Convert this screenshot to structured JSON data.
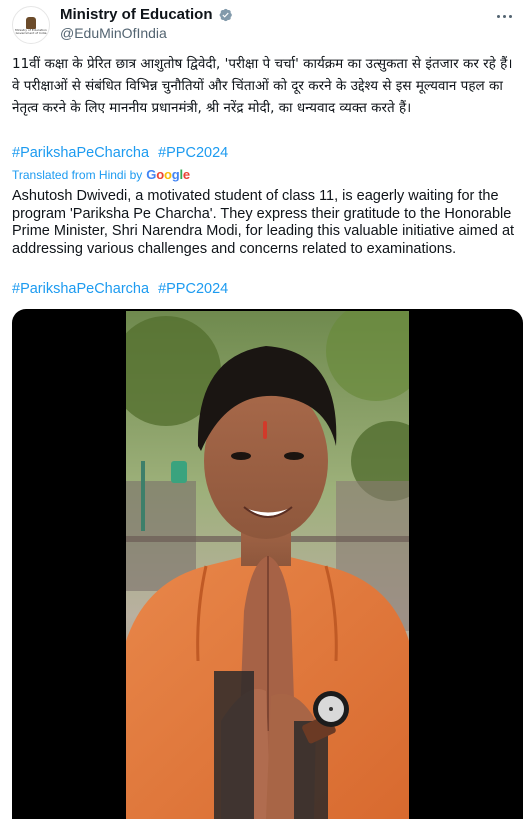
{
  "tweet": {
    "display_name": "Ministry of Education",
    "handle": "@EduMinOfIndia",
    "avatar_text": [
      "Ministry of Education",
      "Government of India"
    ],
    "hindi_text": "11वीं कक्षा के प्रेरित छात्र आशुतोष द्विवेदी, 'परीक्षा पे चर्चा' कार्यक्रम का उत्सुकता से इंतजार कर रहे हैं। वे परीक्षाओं से संबंधित विभिन्न चुनौतियों और चिंताओं को दूर करने के उद्देश्य से इस मूल्यवान पहल का नेतृत्व करने के लिए माननीय प्रधानमंत्री, श्री नरेंद्र मोदी, का धन्यवाद व्यक्त करते हैं।",
    "hashtags_top": [
      "#ParikshaPeCharcha",
      "#PPC2024"
    ],
    "translated_label": "Translated from Hindi by",
    "google_letters": [
      "G",
      "o",
      "o",
      "g",
      "l",
      "e"
    ],
    "english_text": "Ashutosh Dwivedi, a motivated student of class 11, is eagerly waiting for the program 'Pariksha Pe Charcha'. They express their gratitude to the Honorable Prime Minister, Shri Narendra Modi, for leading this valuable initiative aimed at addressing various challenges and concerns related to examinations.",
    "hashtags_bottom": [
      "#ParikshaPeCharcha",
      "#PPC2024"
    ]
  },
  "colors": {
    "link": "#1d9bf0",
    "text": "#0f1419",
    "secondary": "#536471",
    "verified_badge": "#829aab",
    "google": [
      "#4285f4",
      "#ea4335",
      "#fbbc05",
      "#4285f4",
      "#34a853",
      "#ea4335"
    ]
  },
  "icons": {
    "verified": "verified-badge-icon",
    "more": "more-options-icon"
  },
  "media": {
    "type": "video-thumbnail",
    "description_visible": false
  }
}
